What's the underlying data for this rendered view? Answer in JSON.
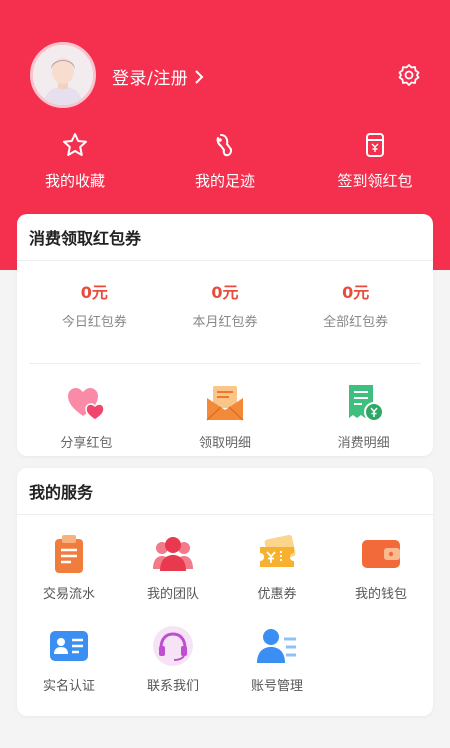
{
  "header": {
    "login_label": "登录/注册",
    "quick_links": [
      {
        "label": "我的收藏",
        "icon": "star-icon"
      },
      {
        "label": "我的足迹",
        "icon": "footprint-icon"
      },
      {
        "label": "签到领红包",
        "icon": "sign-in-envelope-icon"
      }
    ]
  },
  "coupon_card": {
    "title": "消费领取红包券",
    "stats": [
      {
        "value": "0元",
        "label": "今日红包券"
      },
      {
        "value": "0元",
        "label": "本月红包券"
      },
      {
        "value": "0元",
        "label": "全部红包券"
      }
    ],
    "actions": [
      {
        "label": "分享红包",
        "icon": "hearts-icon"
      },
      {
        "label": "领取明细",
        "icon": "envelope-icon"
      },
      {
        "label": "消费明细",
        "icon": "receipt-icon"
      }
    ]
  },
  "services": {
    "title": "我的服务",
    "items": [
      {
        "label": "交易流水",
        "icon": "clipboard-icon"
      },
      {
        "label": "我的团队",
        "icon": "team-icon"
      },
      {
        "label": "优惠券",
        "icon": "coupon-icon"
      },
      {
        "label": "我的钱包",
        "icon": "wallet-icon"
      },
      {
        "label": "实名认证",
        "icon": "id-card-icon"
      },
      {
        "label": "联系我们",
        "icon": "headset-icon"
      },
      {
        "label": "账号管理",
        "icon": "account-icon"
      }
    ]
  },
  "colors": {
    "brand": "#f5304f",
    "stat_value": "#e84c3d"
  }
}
